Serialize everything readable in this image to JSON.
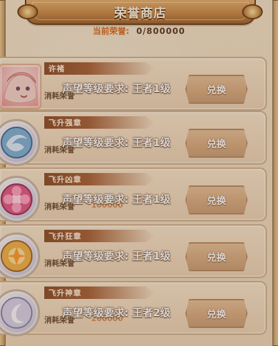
{
  "header": {
    "title": "荣誉商店",
    "honor_label": "当前荣誉:",
    "honor_value": "0/800000"
  },
  "items": [
    {
      "name": "许褚",
      "icon": "portrait-icon",
      "cost_label": "消耗荣誉",
      "requirement": "声望等级要求: 王者1级",
      "button": "兑换"
    },
    {
      "name": "飞升强章",
      "icon": "wind-badge-icon",
      "cost_label": "消耗荣誉",
      "requirement": "声望等级要求: 王者1级",
      "button": "兑换"
    },
    {
      "name": "飞升凶章",
      "icon": "flower-badge-icon",
      "cost_label": "消耗荣誉",
      "requirement": "声望等级要求: 王者1级",
      "button": "兑换",
      "cost_value": "100000"
    },
    {
      "name": "飞升狂章",
      "icon": "fire-badge-icon",
      "cost_label": "消耗荣誉",
      "requirement": "声望等级要求: 王者1级",
      "button": "兑换"
    },
    {
      "name": "飞升神章",
      "icon": "moon-badge-icon",
      "cost_label": "消耗荣誉",
      "requirement": "声望等级要求: 王者2级",
      "button": "兑换",
      "cost_value": "200000"
    }
  ]
}
